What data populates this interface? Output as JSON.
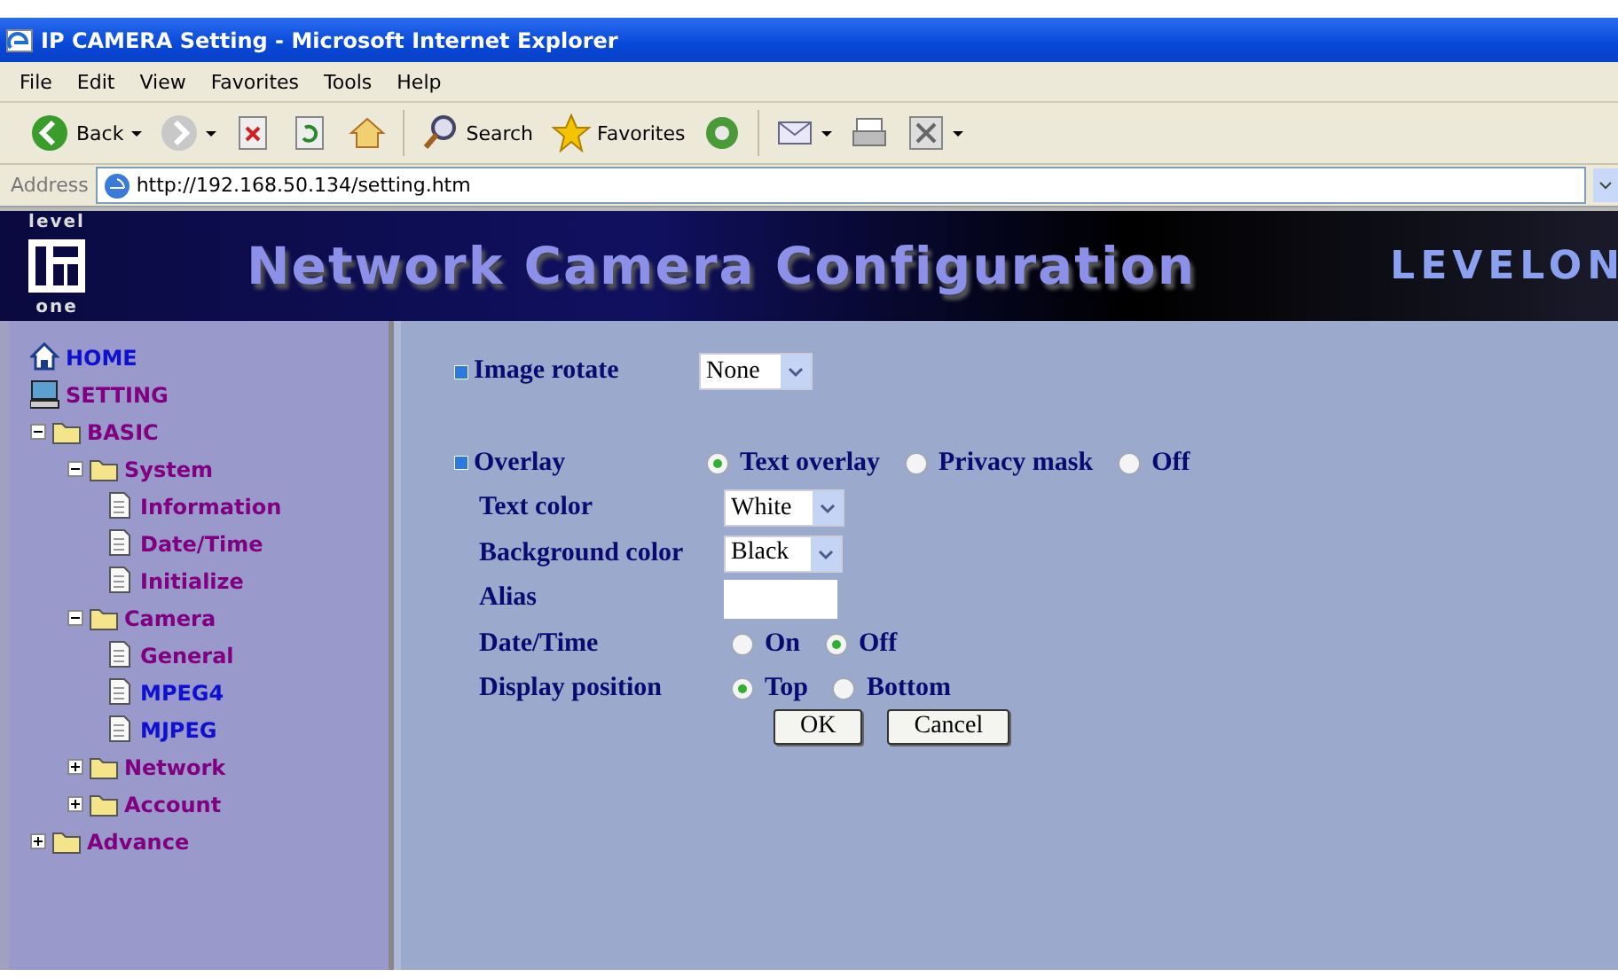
{
  "window": {
    "title": "IP CAMERA Setting - Microsoft Internet Explorer"
  },
  "menu": [
    "File",
    "Edit",
    "View",
    "Favorites",
    "Tools",
    "Help"
  ],
  "toolbar": [
    {
      "kind": "back",
      "label": "Back",
      "dropdown": true
    },
    {
      "kind": "forward",
      "dropdown": true
    },
    {
      "kind": "stop",
      "dropdown": false
    },
    {
      "kind": "refresh",
      "dropdown": false
    },
    {
      "kind": "home",
      "dropdown": false
    },
    {
      "kind": "search",
      "label": "Search",
      "dropdown": false
    },
    {
      "kind": "favorites",
      "label": "Favorites",
      "dropdown": false
    },
    {
      "kind": "media",
      "dropdown": false
    },
    {
      "kind": "mail",
      "dropdown": true
    },
    {
      "kind": "print",
      "dropdown": false
    },
    {
      "kind": "edit",
      "dropdown": true
    }
  ],
  "address": {
    "label": "Address",
    "url": "http://192.168.50.134/setting.htm"
  },
  "banner": {
    "logo_top": "level",
    "logo_bottom": "one",
    "title": "Network Camera Configuration",
    "brand": "LEVELON"
  },
  "tree": [
    {
      "kind": "home",
      "label": "HOME",
      "color": "#1010d0"
    },
    {
      "kind": "setting",
      "label": "SETTING",
      "color": "#800080"
    },
    {
      "kind": "folder",
      "label": "BASIC",
      "color": "#800080",
      "expanded": true,
      "children": [
        {
          "kind": "folder",
          "label": "System",
          "color": "#800080",
          "expanded": true,
          "children": [
            {
              "kind": "page",
              "label": "Information",
              "color": "#800080"
            },
            {
              "kind": "page",
              "label": "Date/Time",
              "color": "#800080"
            },
            {
              "kind": "page",
              "label": "Initialize",
              "color": "#800080"
            }
          ]
        },
        {
          "kind": "folder",
          "label": "Camera",
          "color": "#800080",
          "expanded": true,
          "children": [
            {
              "kind": "page",
              "label": "General",
              "color": "#800080"
            },
            {
              "kind": "page",
              "label": "MPEG4",
              "color": "#1010d0"
            },
            {
              "kind": "page",
              "label": "MJPEG",
              "color": "#1010d0"
            }
          ]
        },
        {
          "kind": "folder",
          "label": "Network",
          "color": "#800080",
          "expanded": false
        },
        {
          "kind": "folder",
          "label": "Account",
          "color": "#800080",
          "expanded": false
        }
      ]
    },
    {
      "kind": "folder",
      "label": "Advance",
      "color": "#800080",
      "expanded": false
    }
  ],
  "form": {
    "rows": [
      {
        "kind": "select",
        "heading": true,
        "label": "Image rotate",
        "value": "None"
      },
      {
        "kind": "radio",
        "heading": true,
        "label": "Overlay",
        "options": [
          {
            "label": "Text overlay",
            "selected": true
          },
          {
            "label": "Privacy mask",
            "selected": false
          },
          {
            "label": "Off",
            "selected": false
          }
        ]
      },
      {
        "kind": "select",
        "heading": false,
        "label": "Text color",
        "value": "White"
      },
      {
        "kind": "select",
        "heading": false,
        "label": "Background color",
        "value": "Black"
      },
      {
        "kind": "input",
        "heading": false,
        "label": "Alias"
      },
      {
        "kind": "radio",
        "heading": false,
        "label": "Date/Time",
        "options": [
          {
            "label": "On",
            "selected": false
          },
          {
            "label": "Off",
            "selected": true
          }
        ]
      },
      {
        "kind": "radio",
        "heading": false,
        "label": "Display position",
        "options": [
          {
            "label": "Top",
            "selected": true
          },
          {
            "label": "Bottom",
            "selected": false
          }
        ]
      }
    ],
    "buttons": [
      "OK",
      "Cancel"
    ]
  }
}
